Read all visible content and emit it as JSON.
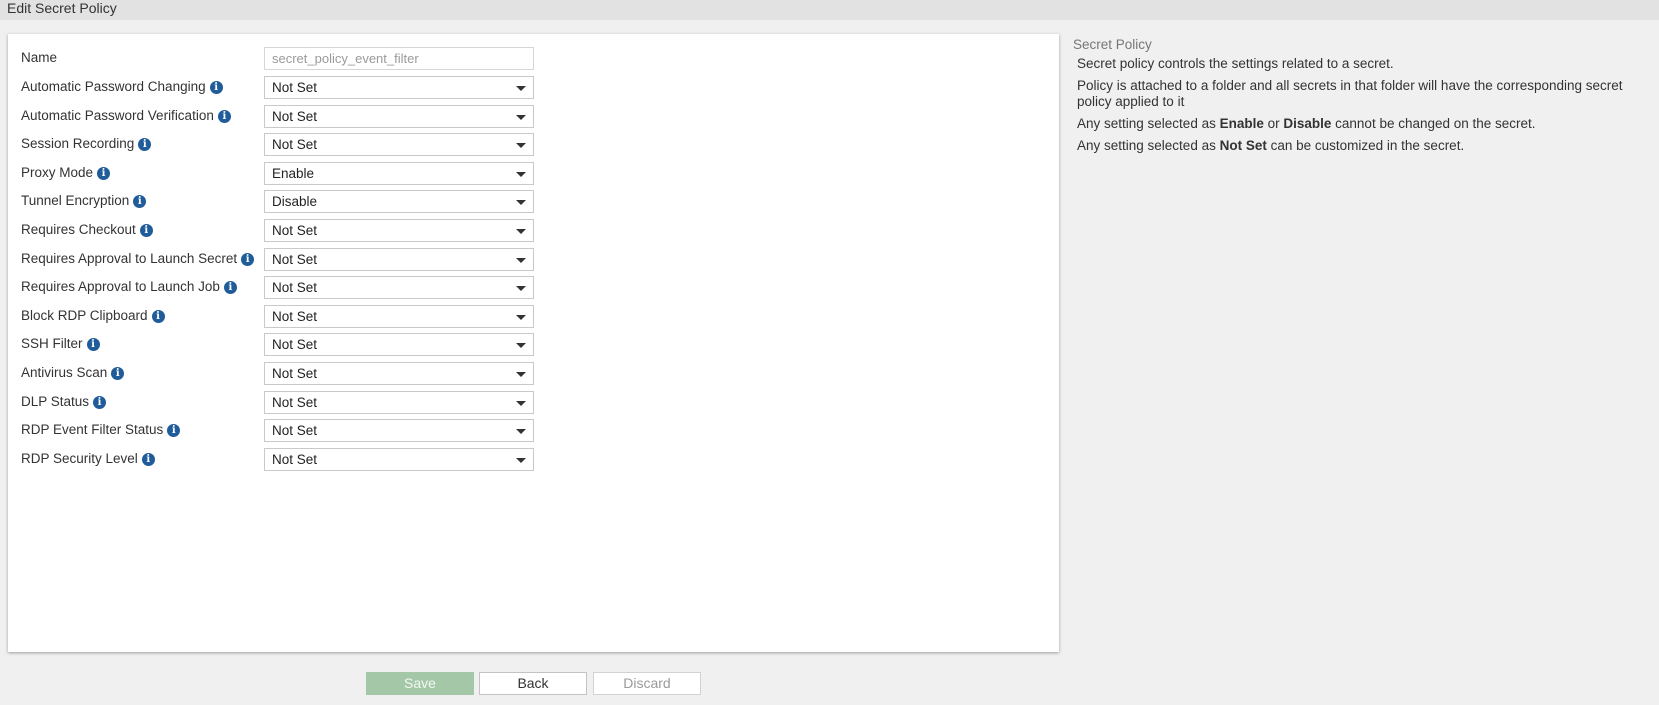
{
  "window": {
    "title": "Edit Secret Policy"
  },
  "form": {
    "name": {
      "label": "Name",
      "value": "secret_policy_event_filter"
    },
    "fields": [
      {
        "label": "Automatic Password Changing",
        "value": "Not Set"
      },
      {
        "label": "Automatic Password Verification",
        "value": "Not Set"
      },
      {
        "label": "Session Recording",
        "value": "Not Set"
      },
      {
        "label": "Proxy Mode",
        "value": "Enable"
      },
      {
        "label": "Tunnel Encryption",
        "value": "Disable"
      },
      {
        "label": "Requires Checkout",
        "value": "Not Set"
      },
      {
        "label": "Requires Approval to Launch Secret",
        "value": "Not Set"
      },
      {
        "label": "Requires Approval to Launch Job",
        "value": "Not Set"
      },
      {
        "label": "Block RDP Clipboard",
        "value": "Not Set"
      },
      {
        "label": "SSH Filter",
        "value": "Not Set"
      },
      {
        "label": "Antivirus Scan",
        "value": "Not Set"
      },
      {
        "label": "DLP Status",
        "value": "Not Set"
      },
      {
        "label": "RDP Event Filter Status",
        "value": "Not Set"
      },
      {
        "label": "RDP Security Level",
        "value": "Not Set"
      }
    ]
  },
  "help": {
    "heading": "Secret Policy",
    "line1": "Secret policy controls the settings related to a secret.",
    "line2": "Policy is attached to a folder and all secrets in that folder will have the corresponding secret policy applied to it",
    "line3_pre": "Any setting selected as ",
    "line3_enable": "Enable",
    "line3_or": " or ",
    "line3_disable": "Disable",
    "line3_post": " cannot be changed on the secret.",
    "line4_pre": "Any setting selected as ",
    "line4_notset": "Not Set",
    "line4_post": " can be customized in the secret."
  },
  "buttons": {
    "save": "Save",
    "back": "Back",
    "discard": "Discard"
  },
  "icons": {
    "info": "info-icon",
    "dropdown": "chevron-down-icon"
  },
  "colors": {
    "info_icon": "#1f5c99",
    "save_button": "#a3c7a7"
  }
}
